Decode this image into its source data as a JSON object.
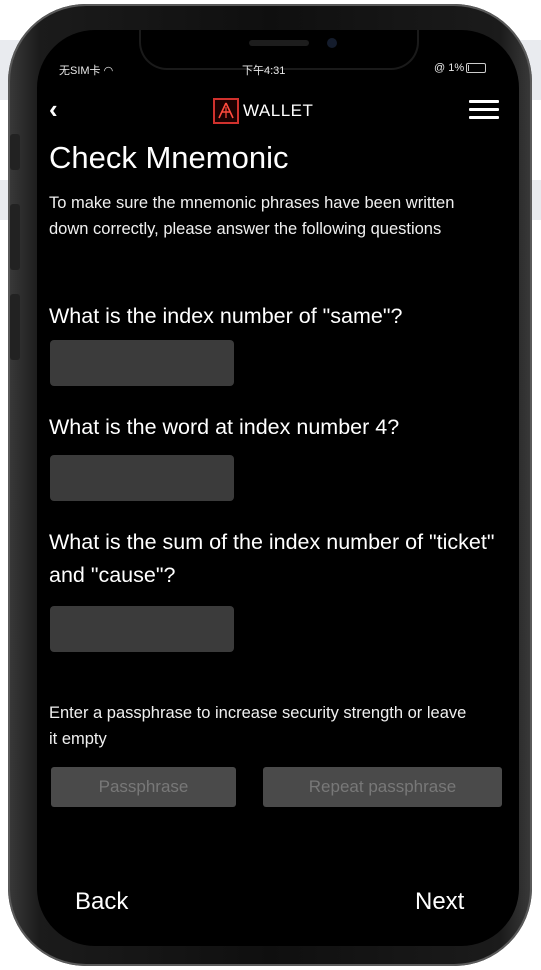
{
  "status_bar": {
    "carrier": "无SIM卡 ",
    "time": "下午4:31",
    "battery": "@ 1%"
  },
  "header": {
    "brand": "WALLET",
    "icons": [
      "chevron-left-icon",
      "wallet-logo-icon",
      "hamburger-menu-icon"
    ]
  },
  "page": {
    "title": "Check Mnemonic",
    "intro": "To make sure the mnemonic phrases have been written down correctly, please answer the following questions"
  },
  "questions": [
    {
      "text": "What is the index number of \"same\"?",
      "value": ""
    },
    {
      "text": "What is the word at index number 4?",
      "value": ""
    },
    {
      "text": "What is the sum of the index number of \"ticket\" and \"cause\"?",
      "value": ""
    }
  ],
  "passphrase": {
    "label": "Enter a passphrase to increase security strength or leave it empty",
    "placeholder": "Passphrase",
    "confirm_placeholder": "Repeat passphrase"
  },
  "footer": {
    "back": "Back",
    "next": "Next"
  },
  "colors": {
    "screen_bg": "#000000",
    "field_bg": "#3b3b3b",
    "logo_red": "#d0312d"
  }
}
